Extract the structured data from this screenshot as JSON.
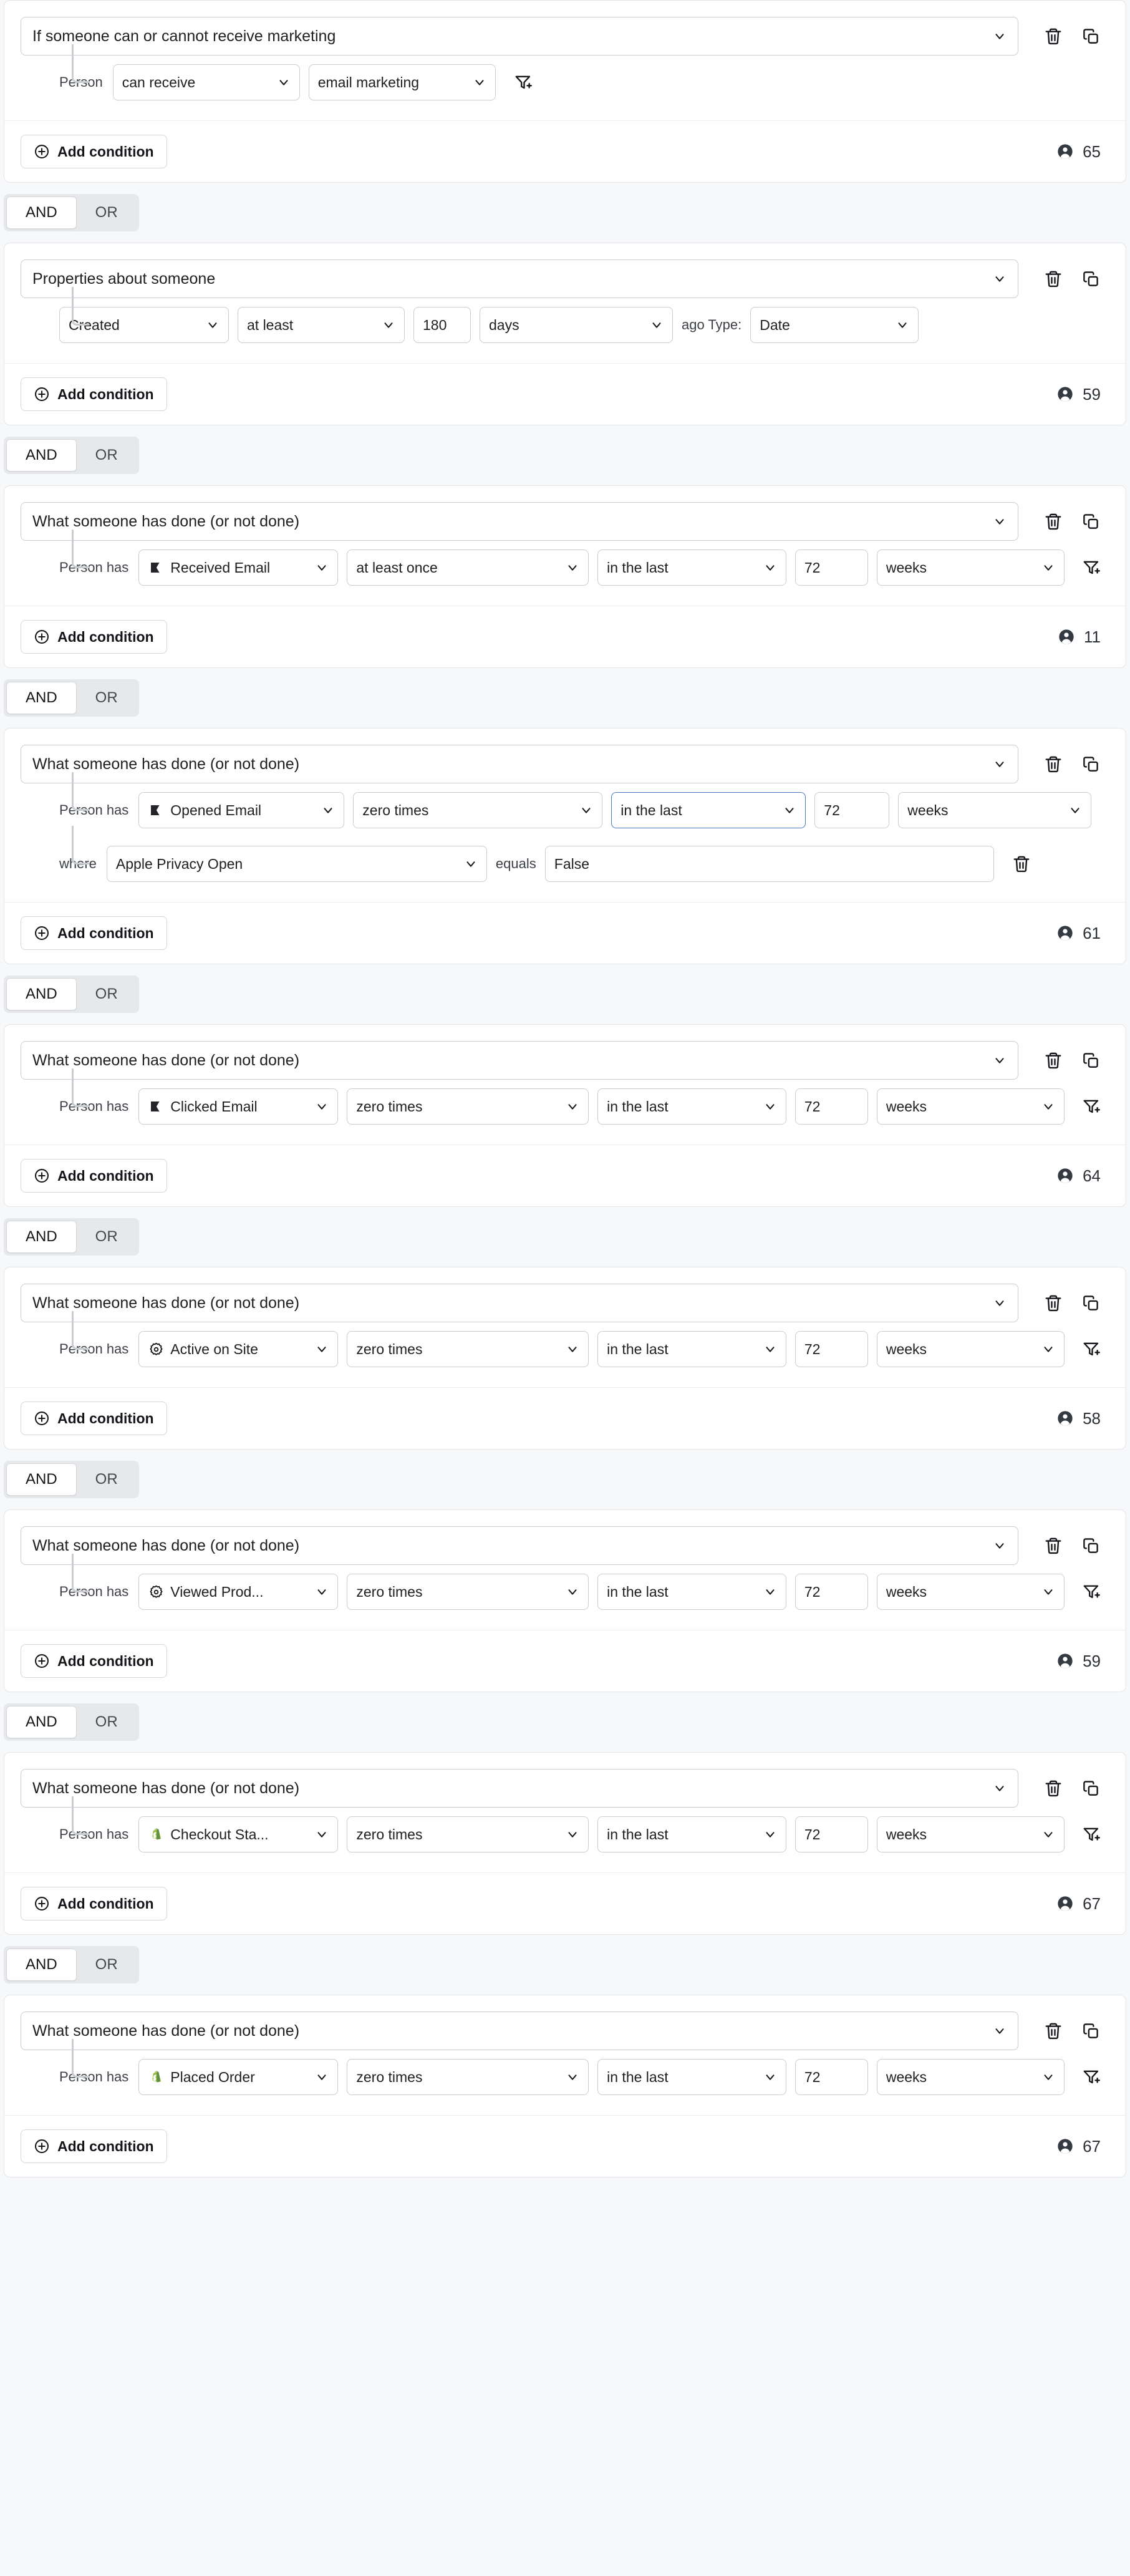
{
  "labels": {
    "add_condition": "Add condition",
    "person_prefix": "Person",
    "person_has_prefix": "Person has",
    "where_prefix": "where",
    "equals_prefix": "equals",
    "ago_type_prefix": "ago Type:",
    "and": "AND",
    "or": "OR"
  },
  "icons": {
    "trash": "trash-icon",
    "duplicate": "duplicate-icon",
    "add_filter": "add-filter-icon",
    "plus_circle": "plus-circle-icon",
    "person": "person-icon",
    "chevron_down": "chevron-down-icon",
    "klaviyo": "klaviyo-icon",
    "gear": "gear-icon",
    "shopify": "shopify-icon"
  },
  "colors": {
    "page_bg": "#f7f8fa",
    "card_bg": "#ffffff",
    "border": "#c9ccd1",
    "focus_border": "#4a77c4",
    "shopify_green": "#95bf47",
    "klaviyo_black": "#232529"
  },
  "blocks": [
    {
      "title": "If someone can or cannot receive marketing",
      "count": "65",
      "joiner_after": {
        "selected": "AND"
      },
      "rows": [
        {
          "prefix": "Person",
          "has_filter_icon": true,
          "fields": [
            {
              "kind": "select",
              "value": "can receive",
              "width": "w-per"
            },
            {
              "kind": "select",
              "value": "email marketing",
              "width": "w-per"
            }
          ]
        }
      ]
    },
    {
      "title": "Properties about someone",
      "count": "59",
      "joiner_after": {
        "selected": "AND"
      },
      "rows": [
        {
          "prefix": "",
          "has_filter_icon": false,
          "fields": [
            {
              "kind": "select",
              "value": "Created",
              "width": "w-attr"
            },
            {
              "kind": "select",
              "value": "at least",
              "width": "w-cmp"
            },
            {
              "kind": "input",
              "value": "180",
              "width": "w-qty"
            },
            {
              "kind": "select",
              "value": "days",
              "width": "w-unit"
            },
            {
              "kind": "text",
              "value": "ago Type:"
            },
            {
              "kind": "select",
              "value": "Date",
              "width": "w-type"
            }
          ]
        }
      ]
    },
    {
      "title": "What someone has done (or not done)",
      "count": "11",
      "joiner_after": {
        "selected": "AND"
      },
      "rows": [
        {
          "prefix": "Person has",
          "has_filter_icon": true,
          "fields": [
            {
              "kind": "select",
              "value": "Received Email",
              "width": "fixed-w",
              "icon": "klaviyo"
            },
            {
              "kind": "select",
              "value": "at least once",
              "width": "w-op"
            },
            {
              "kind": "select",
              "value": "in the last",
              "width": "w-time"
            },
            {
              "kind": "input",
              "value": "72",
              "width": "w-num"
            },
            {
              "kind": "select",
              "value": "weeks",
              "width": "w-unit"
            }
          ]
        }
      ]
    },
    {
      "title": "What someone has done (or not done)",
      "count": "61",
      "joiner_after": {
        "selected": "AND"
      },
      "rows": [
        {
          "prefix": "Person has",
          "has_filter_icon": false,
          "fields": [
            {
              "kind": "select",
              "value": "Opened Email",
              "width": "fixed-w",
              "icon": "klaviyo"
            },
            {
              "kind": "select",
              "value": "zero times",
              "width": "w-op"
            },
            {
              "kind": "select",
              "value": "in the last",
              "width": "w-time",
              "focused": true
            },
            {
              "kind": "input",
              "value": "72",
              "width": "w-num"
            },
            {
              "kind": "select",
              "value": "weeks",
              "width": "w-unit"
            }
          ]
        },
        {
          "prefix": "where",
          "has_trash_icon": true,
          "fields": [
            {
              "kind": "select",
              "value": "Apple Privacy Open",
              "width": "w-where"
            },
            {
              "kind": "text",
              "value": "equals"
            },
            {
              "kind": "input",
              "value": "False",
              "width": "w-val"
            }
          ]
        }
      ]
    },
    {
      "title": "What someone has done (or not done)",
      "count": "64",
      "joiner_after": {
        "selected": "AND"
      },
      "rows": [
        {
          "prefix": "Person has",
          "has_filter_icon": true,
          "fields": [
            {
              "kind": "select",
              "value": "Clicked Email",
              "width": "fixed-w",
              "icon": "klaviyo"
            },
            {
              "kind": "select",
              "value": "zero times",
              "width": "w-op"
            },
            {
              "kind": "select",
              "value": "in the last",
              "width": "w-time"
            },
            {
              "kind": "input",
              "value": "72",
              "width": "w-num"
            },
            {
              "kind": "select",
              "value": "weeks",
              "width": "w-unit"
            }
          ]
        }
      ]
    },
    {
      "title": "What someone has done (or not done)",
      "count": "58",
      "joiner_after": {
        "selected": "AND"
      },
      "rows": [
        {
          "prefix": "Person has",
          "has_filter_icon": true,
          "fields": [
            {
              "kind": "select",
              "value": "Active on Site",
              "width": "fixed-w",
              "icon": "gear"
            },
            {
              "kind": "select",
              "value": "zero times",
              "width": "w-op"
            },
            {
              "kind": "select",
              "value": "in the last",
              "width": "w-time"
            },
            {
              "kind": "input",
              "value": "72",
              "width": "w-num"
            },
            {
              "kind": "select",
              "value": "weeks",
              "width": "w-unit"
            }
          ]
        }
      ]
    },
    {
      "title": "What someone has done (or not done)",
      "count": "59",
      "joiner_after": {
        "selected": "AND"
      },
      "rows": [
        {
          "prefix": "Person has",
          "has_filter_icon": true,
          "fields": [
            {
              "kind": "select",
              "value": "Viewed Prod...",
              "width": "fixed-w",
              "icon": "gear"
            },
            {
              "kind": "select",
              "value": "zero times",
              "width": "w-op"
            },
            {
              "kind": "select",
              "value": "in the last",
              "width": "w-time"
            },
            {
              "kind": "input",
              "value": "72",
              "width": "w-num"
            },
            {
              "kind": "select",
              "value": "weeks",
              "width": "w-unit"
            }
          ]
        }
      ]
    },
    {
      "title": "What someone has done (or not done)",
      "count": "67",
      "joiner_after": {
        "selected": "AND"
      },
      "rows": [
        {
          "prefix": "Person has",
          "has_filter_icon": true,
          "fields": [
            {
              "kind": "select",
              "value": "Checkout Sta...",
              "width": "fixed-w",
              "icon": "shopify"
            },
            {
              "kind": "select",
              "value": "zero times",
              "width": "w-op"
            },
            {
              "kind": "select",
              "value": "in the last",
              "width": "w-time"
            },
            {
              "kind": "input",
              "value": "72",
              "width": "w-num"
            },
            {
              "kind": "select",
              "value": "weeks",
              "width": "w-unit"
            }
          ]
        }
      ]
    },
    {
      "title": "What someone has done (or not done)",
      "count": "67",
      "joiner_after": null,
      "main_focused": true,
      "rows": [
        {
          "prefix": "Person has",
          "has_filter_icon": true,
          "fields": [
            {
              "kind": "select",
              "value": "Placed Order",
              "width": "fixed-w",
              "icon": "shopify"
            },
            {
              "kind": "select",
              "value": "zero times",
              "width": "w-op"
            },
            {
              "kind": "select",
              "value": "in the last",
              "width": "w-time"
            },
            {
              "kind": "input",
              "value": "72",
              "width": "w-num"
            },
            {
              "kind": "select",
              "value": "weeks",
              "width": "w-unit"
            }
          ]
        }
      ]
    }
  ]
}
